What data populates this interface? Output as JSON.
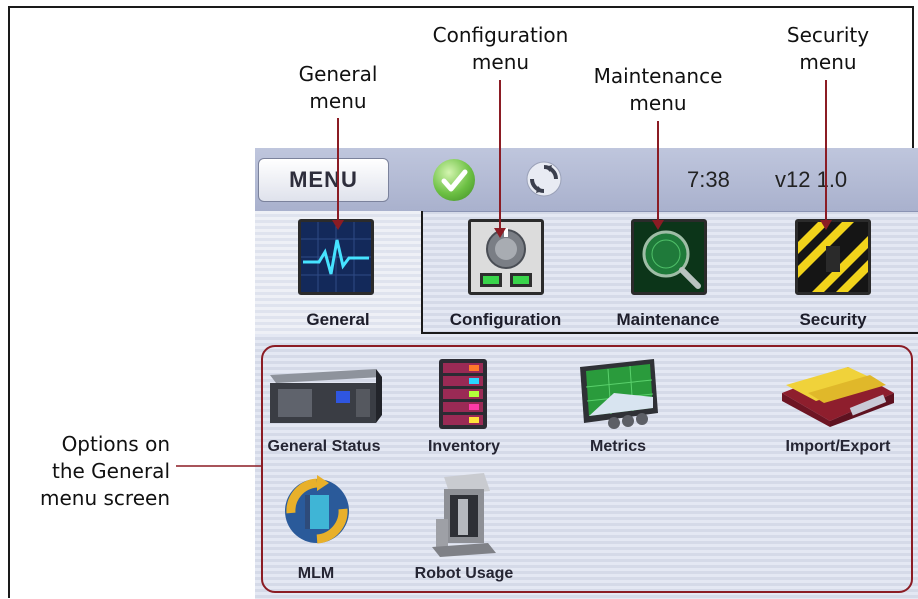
{
  "callouts": {
    "general": "General\nmenu",
    "configuration": "Configuration\nmenu",
    "maintenance": "Maintenance\nmenu",
    "security": "Security\nmenu",
    "options": "Options on\nthe General\nmenu screen"
  },
  "topbar": {
    "menu_label": "MENU",
    "time": "7:38",
    "version": "v12 1.0"
  },
  "tabs": [
    {
      "label": "General",
      "icon": "heartbeat-monitor-icon",
      "active": true
    },
    {
      "label": "Configuration",
      "icon": "dial-config-icon",
      "active": false
    },
    {
      "label": "Maintenance",
      "icon": "magnifier-icon",
      "active": false
    },
    {
      "label": "Security",
      "icon": "hazard-stripes-icon",
      "active": false
    }
  ],
  "options": [
    {
      "label": "General Status",
      "icon": "library-unit-icon"
    },
    {
      "label": "Inventory",
      "icon": "tape-rack-icon"
    },
    {
      "label": "Metrics",
      "icon": "chart-display-icon"
    },
    {
      "label": "Import/Export",
      "icon": "import-export-icon"
    },
    {
      "label": "MLM",
      "icon": "media-lifecycle-icon"
    },
    {
      "label": "Robot Usage",
      "icon": "robot-icon"
    }
  ],
  "colors": {
    "callout_arrow": "#8b1c24",
    "panel_border": "#8b1c24",
    "ok_green": "#6cc043"
  }
}
